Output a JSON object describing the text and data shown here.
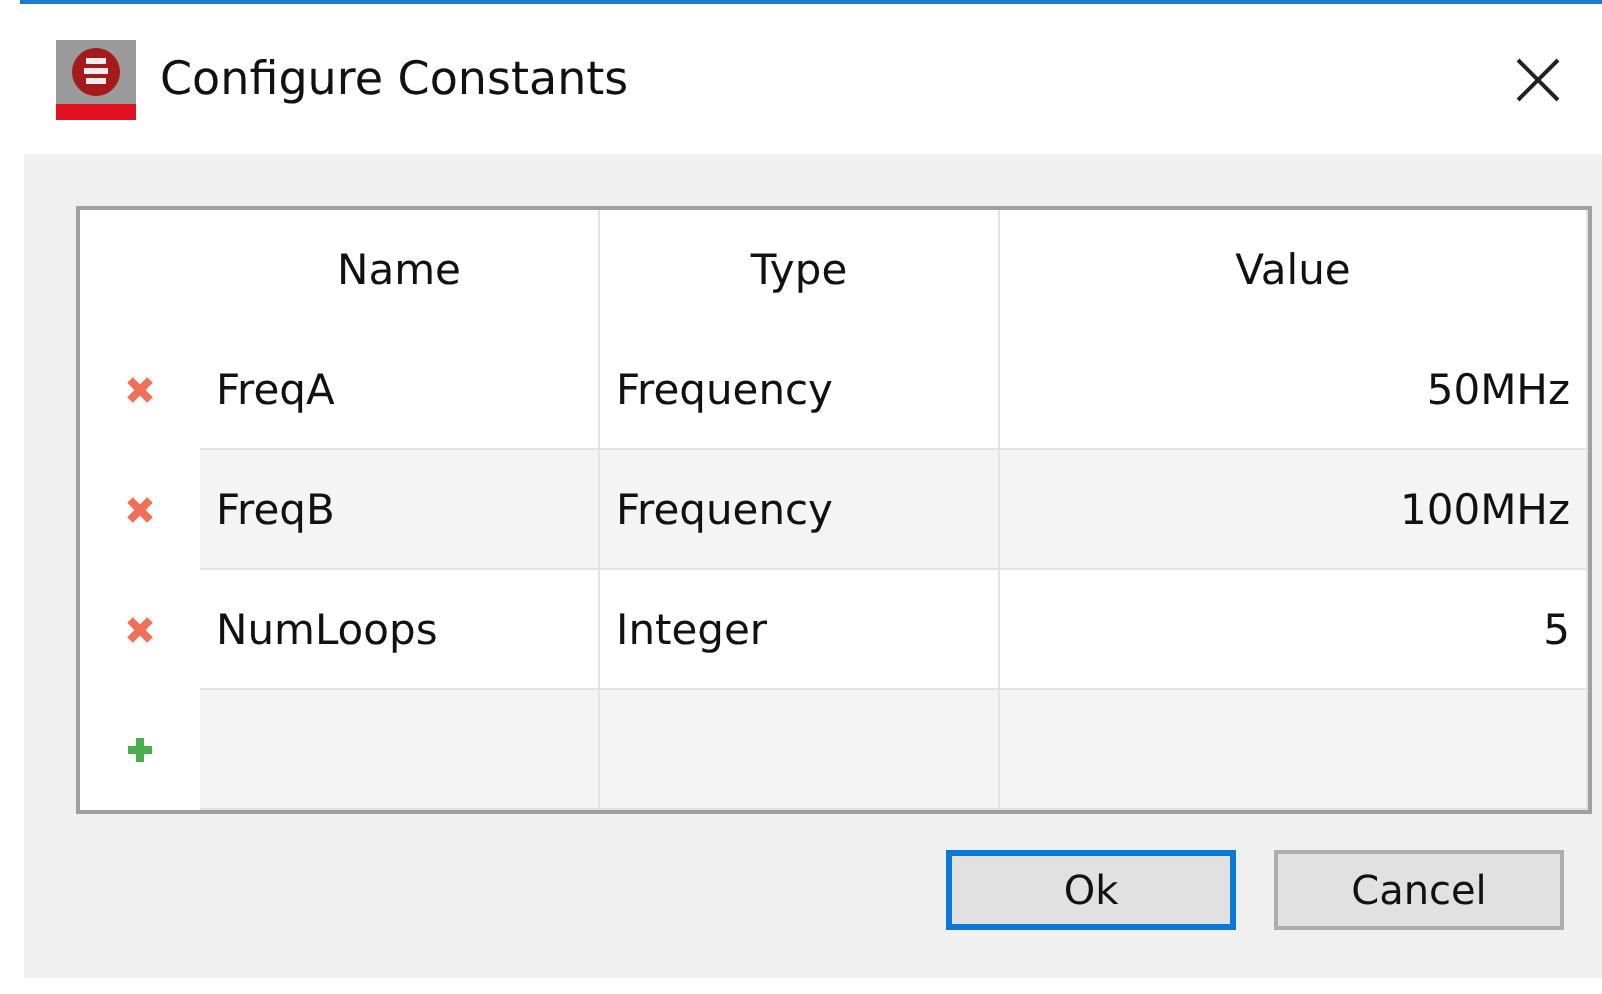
{
  "window": {
    "title": "Configure Constants"
  },
  "table": {
    "columns": [
      "Name",
      "Type",
      "Value"
    ],
    "rows": [
      {
        "kind": "constant",
        "cells": [
          "FreqA",
          "Frequency",
          "50MHz"
        ]
      },
      {
        "kind": "constant",
        "cells": [
          "FreqB",
          "Frequency",
          "100MHz"
        ]
      },
      {
        "kind": "constant",
        "cells": [
          "NumLoops",
          "Integer",
          "5"
        ]
      },
      {
        "kind": "new"
      }
    ]
  },
  "buttons": [
    {
      "label": "Ok",
      "selected": true
    },
    {
      "label": "Cancel",
      "selected": false
    }
  ]
}
